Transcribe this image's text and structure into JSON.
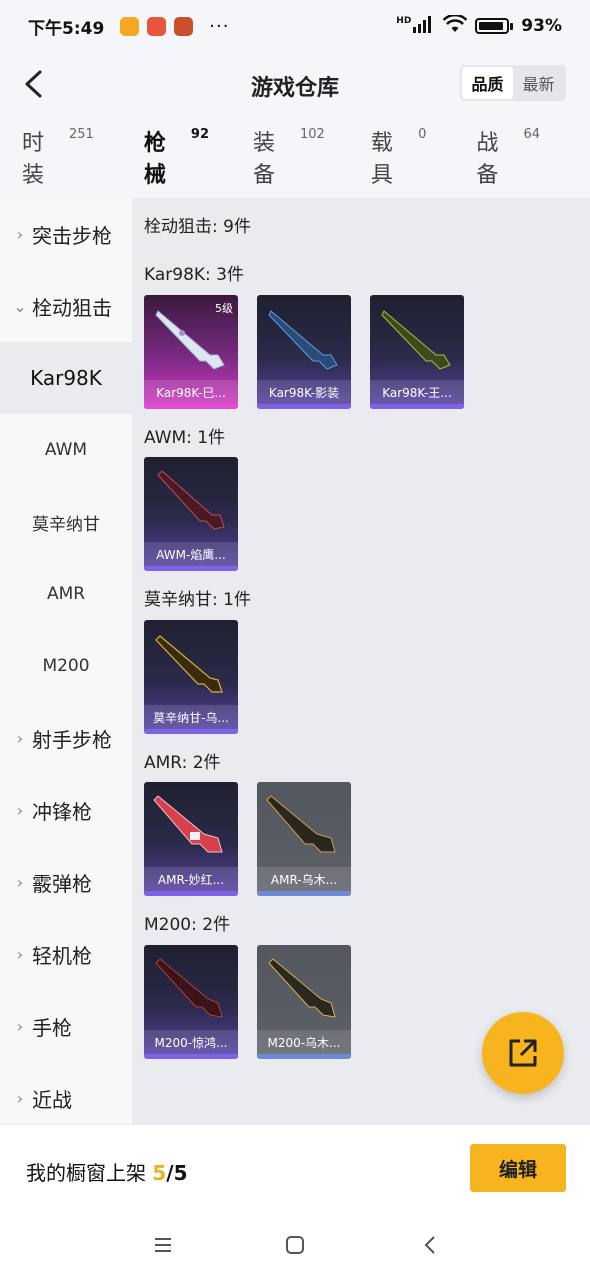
{
  "status_bar": {
    "time": "下午5:49",
    "dots": "···",
    "network": "HD",
    "battery": "93%",
    "app_icon_colors": [
      "#f5a623",
      "#e8553d",
      "#c9502a"
    ]
  },
  "header": {
    "title": "游戏仓库",
    "sort_options": [
      "品质",
      "最新"
    ],
    "sort_active": "品质"
  },
  "tabs": [
    {
      "label": "时装",
      "count": "251"
    },
    {
      "label": "枪械",
      "count": "92"
    },
    {
      "label": "装备",
      "count": "102"
    },
    {
      "label": "载具",
      "count": "0"
    },
    {
      "label": "战备",
      "count": "64"
    }
  ],
  "sidebar": {
    "items": [
      {
        "label": "突击步枪",
        "type": "group"
      },
      {
        "label": "栓动狙击",
        "type": "group-open"
      },
      {
        "label": "Kar98K",
        "type": "sub-selected"
      },
      {
        "label": "AWM",
        "type": "sub"
      },
      {
        "label": "莫辛纳甘",
        "type": "sub"
      },
      {
        "label": "AMR",
        "type": "sub"
      },
      {
        "label": "M200",
        "type": "sub"
      },
      {
        "label": "射手步枪",
        "type": "group"
      },
      {
        "label": "冲锋枪",
        "type": "group"
      },
      {
        "label": "霰弹枪",
        "type": "group"
      },
      {
        "label": "轻机枪",
        "type": "group"
      },
      {
        "label": "手枪",
        "type": "group"
      },
      {
        "label": "近战",
        "type": "group"
      }
    ]
  },
  "content": {
    "summary": "栓动狙击: 9件",
    "sections": [
      {
        "title": "Kar98K: 3件",
        "items": [
          {
            "name": "Kar98K-巳...",
            "quality": "pink",
            "level": "5级"
          },
          {
            "name": "Kar98K-影装",
            "quality": "purple",
            "level": ""
          },
          {
            "name": "Kar98K-王...",
            "quality": "purple",
            "level": ""
          }
        ]
      },
      {
        "title": "AWM: 1件",
        "items": [
          {
            "name": "AWM-焰鹰...",
            "quality": "purple",
            "level": ""
          }
        ]
      },
      {
        "title": "莫辛纳甘: 1件",
        "items": [
          {
            "name": "莫辛纳甘-乌...",
            "quality": "purple",
            "level": ""
          }
        ]
      },
      {
        "title": "AMR: 2件",
        "items": [
          {
            "name": "AMR-妙红...",
            "quality": "purple",
            "level": ""
          },
          {
            "name": "AMR-乌木...",
            "quality": "gray",
            "level": ""
          }
        ]
      },
      {
        "title": "M200: 2件",
        "items": [
          {
            "name": "M200-惊鸿...",
            "quality": "purple",
            "level": ""
          },
          {
            "name": "M200-乌木...",
            "quality": "gray",
            "level": ""
          }
        ]
      }
    ]
  },
  "bottom": {
    "label": "我的橱窗上架",
    "current": "5",
    "separator": "/",
    "total": "5",
    "edit_label": "编辑"
  },
  "colors": {
    "accent": "#f7b41e",
    "purple_quality": "#7e62e8",
    "pink_quality": "#e54bd4"
  }
}
